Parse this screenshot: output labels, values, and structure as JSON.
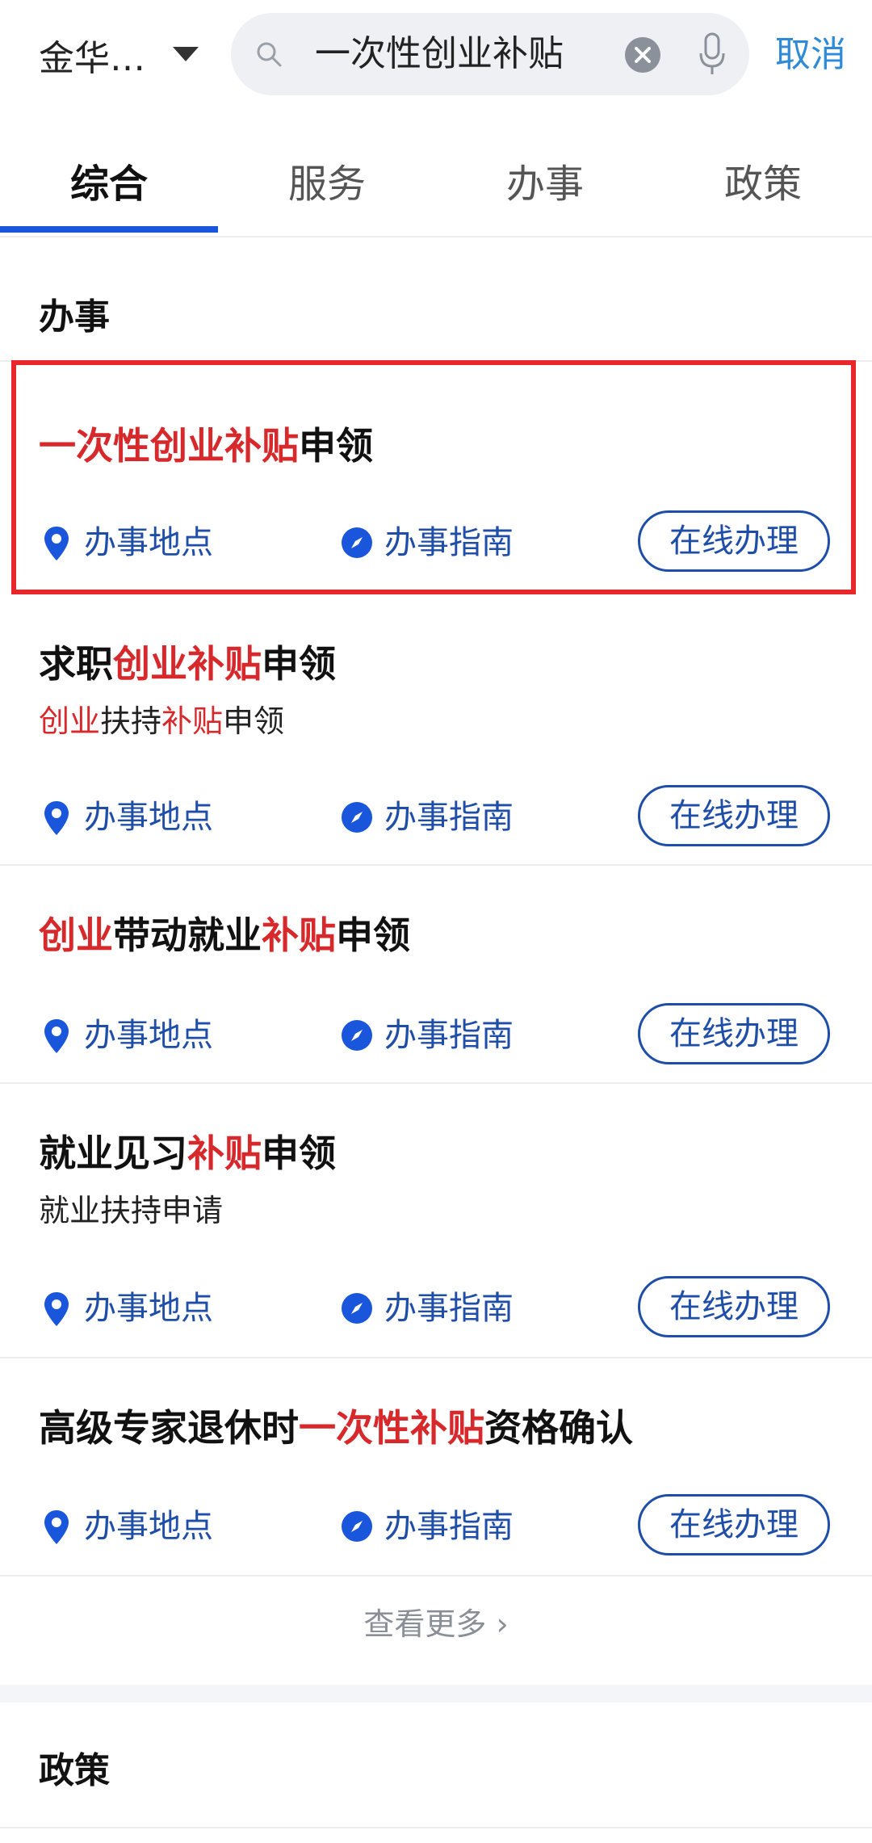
{
  "header": {
    "city": "金华…",
    "search_value": "一次性创业补贴",
    "cancel_label": "取消"
  },
  "tabs": [
    {
      "label": "综合"
    },
    {
      "label": "服务"
    },
    {
      "label": "办事"
    },
    {
      "label": "政策"
    }
  ],
  "sections": {
    "affairs_title": "办事",
    "policy_title": "政策"
  },
  "row_labels": {
    "location": "办事地点",
    "guide": "办事指南",
    "online": "在线办理"
  },
  "items": [
    {
      "title_parts": [
        {
          "t": "一次性创业补贴",
          "h": true
        },
        {
          "t": "申领",
          "h": false
        }
      ],
      "sub_parts": []
    },
    {
      "title_parts": [
        {
          "t": "求职",
          "h": false
        },
        {
          "t": "创业补贴",
          "h": true
        },
        {
          "t": "申领",
          "h": false
        }
      ],
      "sub_parts": [
        {
          "t": "创业",
          "h": true
        },
        {
          "t": "扶持",
          "h": false
        },
        {
          "t": "补贴",
          "h": true
        },
        {
          "t": "申领",
          "h": false
        }
      ]
    },
    {
      "title_parts": [
        {
          "t": "创业",
          "h": true
        },
        {
          "t": "带动就业",
          "h": false
        },
        {
          "t": "补贴",
          "h": true
        },
        {
          "t": "申领",
          "h": false
        }
      ],
      "sub_parts": []
    },
    {
      "title_parts": [
        {
          "t": "就业见习",
          "h": false
        },
        {
          "t": "补贴",
          "h": true
        },
        {
          "t": "申领",
          "h": false
        }
      ],
      "sub_parts": [
        {
          "t": "就业扶持申请",
          "h": false
        }
      ]
    },
    {
      "title_parts": [
        {
          "t": "高级专家退休时",
          "h": false
        },
        {
          "t": "一次性补贴",
          "h": true
        },
        {
          "t": "资格确认",
          "h": false
        }
      ],
      "sub_parts": []
    }
  ],
  "more_label": "查看更多 ›",
  "colors": {
    "highlight": "#d7282b",
    "link": "#1f4ea8",
    "accent": "#1a56db",
    "frame": "#e8272a"
  }
}
